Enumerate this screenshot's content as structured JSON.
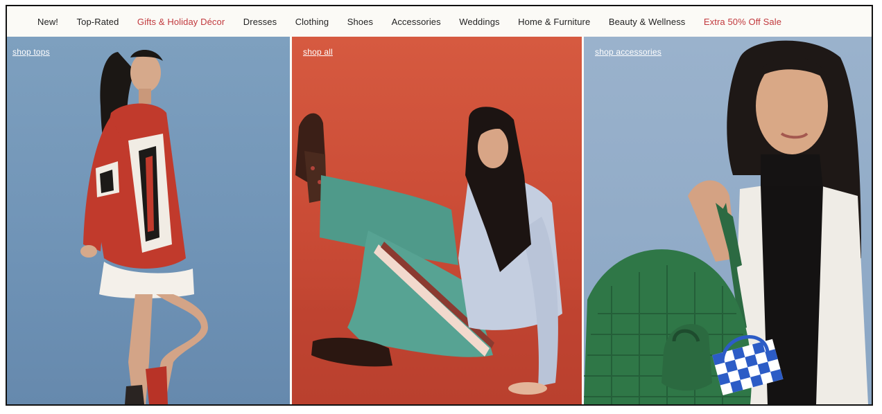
{
  "nav": {
    "items": [
      {
        "label": "New!",
        "accent": false
      },
      {
        "label": "Top-Rated",
        "accent": false
      },
      {
        "label": "Gifts & Holiday Décor",
        "accent": true
      },
      {
        "label": "Dresses",
        "accent": false
      },
      {
        "label": "Clothing",
        "accent": false
      },
      {
        "label": "Shoes",
        "accent": false
      },
      {
        "label": "Accessories",
        "accent": false
      },
      {
        "label": "Weddings",
        "accent": false
      },
      {
        "label": "Home & Furniture",
        "accent": false
      },
      {
        "label": "Beauty & Wellness",
        "accent": false
      },
      {
        "label": "Extra 50% Off Sale",
        "accent": true
      }
    ]
  },
  "panels": [
    {
      "link": "shop tops",
      "background": "#7597b9"
    },
    {
      "link": "shop all",
      "background": "#cf5139"
    },
    {
      "link": "shop accessories",
      "background": "#93adc9"
    }
  ],
  "colors": {
    "accent": "#c1393d",
    "nav_text": "#222222",
    "nav_bg": "#fbfaf6"
  }
}
